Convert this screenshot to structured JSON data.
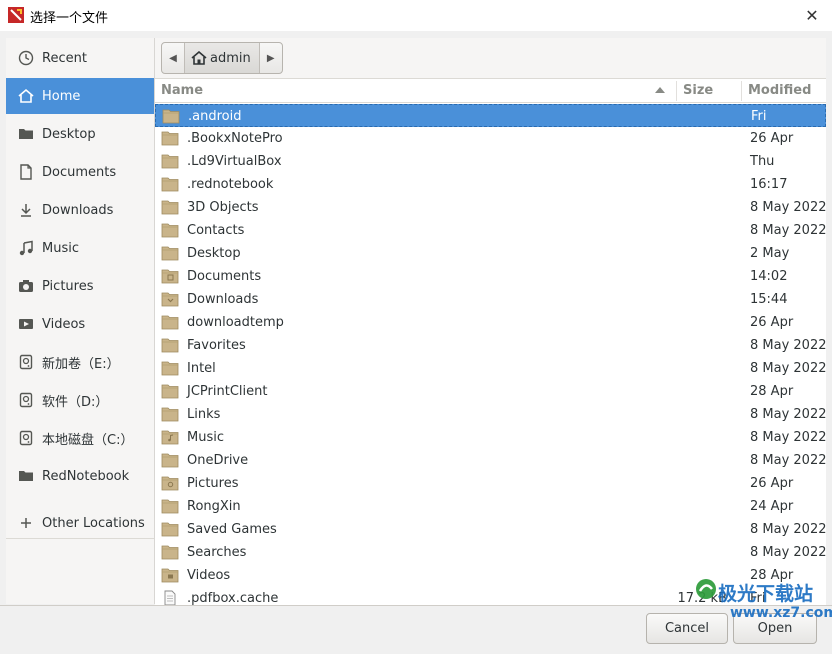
{
  "window": {
    "title": "选择一个文件"
  },
  "sidebar": {
    "items": [
      {
        "label": "Recent",
        "icon": "clock-icon"
      },
      {
        "label": "Home",
        "icon": "home-icon",
        "active": true
      },
      {
        "label": "Desktop",
        "icon": "folder-icon"
      },
      {
        "label": "Documents",
        "icon": "document-icon"
      },
      {
        "label": "Downloads",
        "icon": "download-icon"
      },
      {
        "label": "Music",
        "icon": "music-icon"
      },
      {
        "label": "Pictures",
        "icon": "camera-icon"
      },
      {
        "label": "Videos",
        "icon": "video-icon"
      },
      {
        "label": "新加卷（E:）",
        "icon": "drive-icon"
      },
      {
        "label": "软件（D:）",
        "icon": "drive-icon"
      },
      {
        "label": "本地磁盘（C:）",
        "icon": "drive-icon"
      },
      {
        "label": "RedNotebook",
        "icon": "folder-icon"
      },
      {
        "label": "Other Locations",
        "icon": "plus-icon"
      }
    ]
  },
  "pathbar": {
    "current": "admin"
  },
  "columns": {
    "name": "Name",
    "size": "Size",
    "modified": "Modified"
  },
  "files": [
    {
      "name": ".android",
      "size": "",
      "modified": "Fri",
      "selected": true
    },
    {
      "name": ".BookxNotePro",
      "size": "",
      "modified": "26 Apr"
    },
    {
      "name": ".Ld9VirtualBox",
      "size": "",
      "modified": "Thu"
    },
    {
      "name": ".rednotebook",
      "size": "",
      "modified": "16:17"
    },
    {
      "name": "3D Objects",
      "size": "",
      "modified": "8 May 2022"
    },
    {
      "name": "Contacts",
      "size": "",
      "modified": "8 May 2022"
    },
    {
      "name": "Desktop",
      "size": "",
      "modified": "2 May"
    },
    {
      "name": "Documents",
      "size": "",
      "modified": "14:02"
    },
    {
      "name": "Downloads",
      "size": "",
      "modified": "15:44"
    },
    {
      "name": "downloadtemp",
      "size": "",
      "modified": "26 Apr"
    },
    {
      "name": "Favorites",
      "size": "",
      "modified": "8 May 2022"
    },
    {
      "name": "Intel",
      "size": "",
      "modified": "8 May 2022"
    },
    {
      "name": "JCPrintClient",
      "size": "",
      "modified": "28 Apr"
    },
    {
      "name": "Links",
      "size": "",
      "modified": "8 May 2022"
    },
    {
      "name": "Music",
      "size": "",
      "modified": "8 May 2022"
    },
    {
      "name": "OneDrive",
      "size": "",
      "modified": "8 May 2022"
    },
    {
      "name": "Pictures",
      "size": "",
      "modified": "26 Apr"
    },
    {
      "name": "RongXin",
      "size": "",
      "modified": "24 Apr"
    },
    {
      "name": "Saved Games",
      "size": "",
      "modified": "8 May 2022"
    },
    {
      "name": "Searches",
      "size": "",
      "modified": "8 May 2022"
    },
    {
      "name": "Videos",
      "size": "",
      "modified": "28 Apr"
    },
    {
      "name": ".pdfbox.cache",
      "size": "17.2 kB",
      "modified": "Fri",
      "type": "file"
    }
  ],
  "buttons": {
    "cancel": "Cancel",
    "open": "Open"
  },
  "watermark": {
    "line1": "极光下载站",
    "line2": "www.xz7.com"
  },
  "colors": {
    "accent": "#4a90d9",
    "folder": "#c9b48a"
  }
}
